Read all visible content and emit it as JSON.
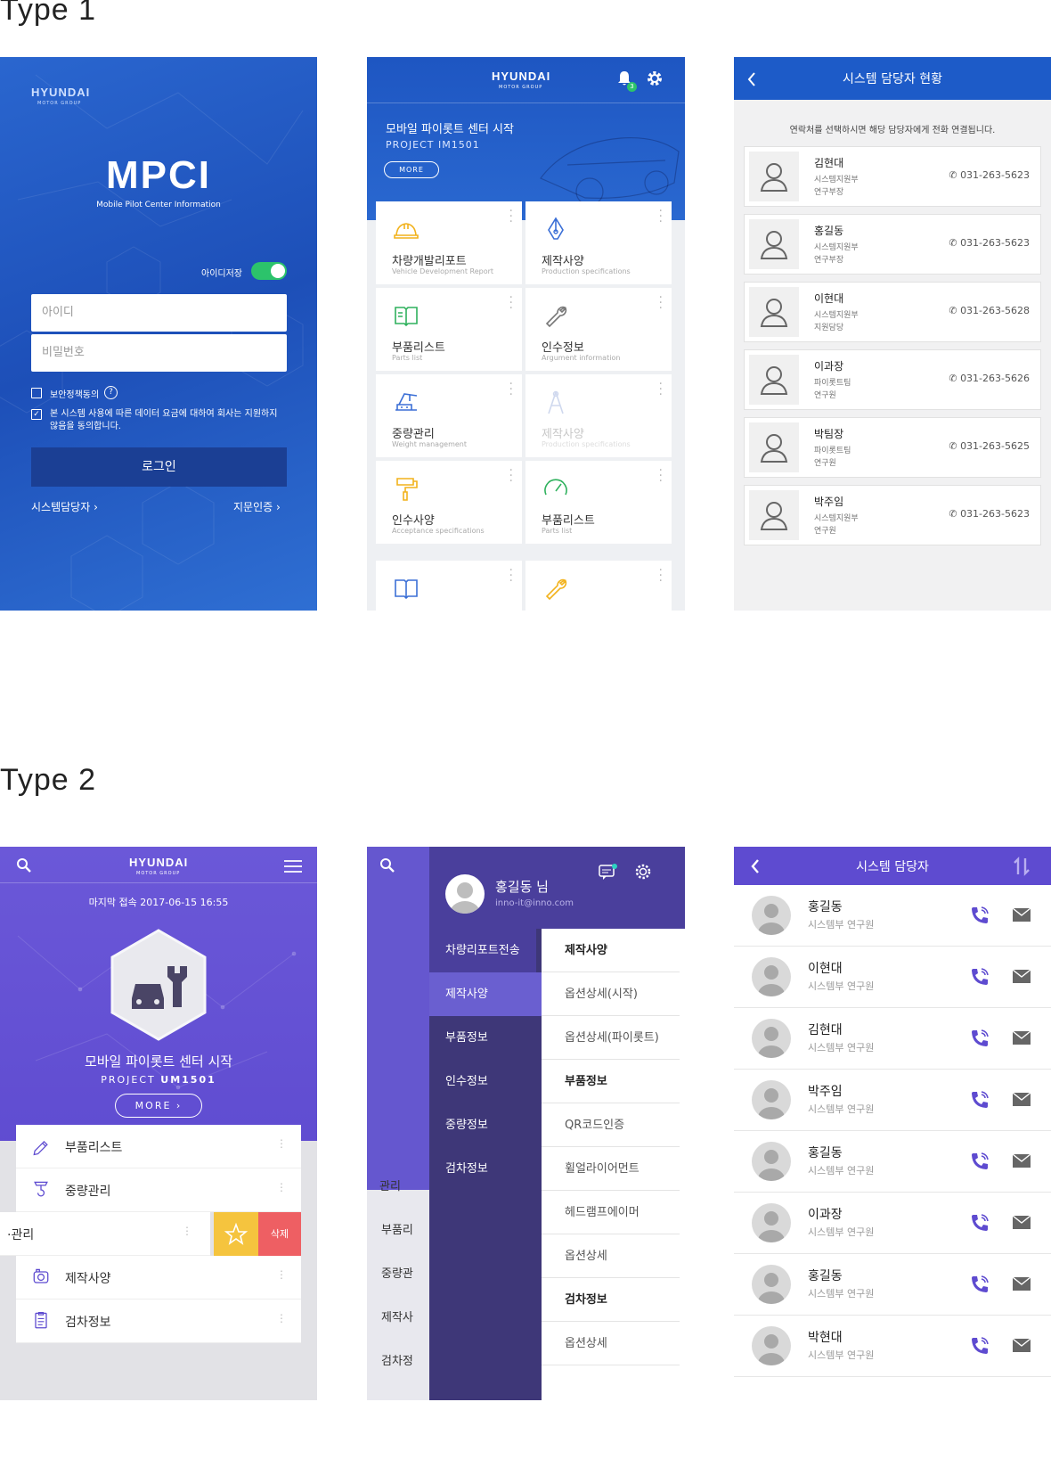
{
  "type1_label": "Type 1",
  "type2_label": "Type 2",
  "brand": {
    "logo": "HYUNDAI",
    "sub": "MOTOR GROUP"
  },
  "login": {
    "app_name": "MPCI",
    "app_full": "Mobile Pilot Center Information",
    "save_id": "아이디저장",
    "id_placeholder": "아이디",
    "pw_placeholder": "비밀번호",
    "security_agree": "보안정책동의",
    "data_agree_1": "본 시스템 사용에 따른 데이터 요금에 대하여 회사는 지원하지",
    "data_agree_2": "않음을 동의합니다.",
    "login_button": "로그인",
    "system_manager": "시스템담당자",
    "fingerprint": "지문인증"
  },
  "dashboard1": {
    "notif_count": "3",
    "banner_title": "모바일 파이롯트 센터 시작",
    "banner_project": "PROJECT IM1501",
    "more": "MORE",
    "tiles": [
      {
        "title": "차량개발리포트",
        "sub": "Vehicle Development Report",
        "icon": "helmet-icon"
      },
      {
        "title": "제작사양",
        "sub": "Production specifications",
        "icon": "pen-nib-icon"
      },
      {
        "title": "부품리스트",
        "sub": "Parts list",
        "icon": "book-icon"
      },
      {
        "title": "인수정보",
        "sub": "Argument information",
        "icon": "wrench-icon"
      },
      {
        "title": "중량관리",
        "sub": "Weight management",
        "icon": "crane-icon"
      },
      {
        "title": "제작사양",
        "sub": "Production specifications",
        "icon": "compass-icon"
      },
      {
        "title": "인수사양",
        "sub": "Acceptance specifications",
        "icon": "paint-roller-icon"
      },
      {
        "title": "부품리스트",
        "sub": "Parts list",
        "icon": "gauge-icon"
      }
    ]
  },
  "contacts1": {
    "title": "시스템 담당자 현황",
    "notice": "연락처를 선택하시면 해당 담당자에게 전화 연결됩니다.",
    "items": [
      {
        "name": "김현대",
        "dept": "시스템지원부",
        "role": "연구부장",
        "phone": "031-263-5623"
      },
      {
        "name": "홍길동",
        "dept": "시스템지원부",
        "role": "연구부장",
        "phone": "031-263-5623"
      },
      {
        "name": "이현대",
        "dept": "시스템지원부",
        "role": "지원담당",
        "phone": "031-263-5628"
      },
      {
        "name": "이과장",
        "dept": "파이롯트팀",
        "role": "연구원",
        "phone": "031-263-5626"
      },
      {
        "name": "박팀장",
        "dept": "파이롯트팀",
        "role": "연구원",
        "phone": "031-263-5625"
      },
      {
        "name": "박주임",
        "dept": "시스템지원부",
        "role": "연구원",
        "phone": "031-263-5623"
      }
    ]
  },
  "dashboard2": {
    "last_access": "마지막 접속 2017-06-15 16:55",
    "banner_title": "모바일 파이롯트 센터 시작",
    "project_prefix": "PROJECT ",
    "project_id": "UM1501",
    "more": "MORE",
    "list": [
      {
        "label": "부품리스트",
        "icon": "pencil-icon"
      },
      {
        "label": "중량관리",
        "icon": "hook-icon"
      },
      {
        "label": "·관리",
        "icon": ""
      },
      {
        "label": "제작사양",
        "icon": "measure-icon"
      },
      {
        "label": "검차정보",
        "icon": "clipboard-icon"
      }
    ],
    "delete": "삭제"
  },
  "drawer": {
    "user_name": "홍길동 님",
    "email": "inno-it@inno.com",
    "behind_items": [
      "관리",
      "부품리",
      "중량관",
      "제작사",
      "검차정"
    ],
    "main_menu": [
      "차량리포트전송",
      "제작사양",
      "부품정보",
      "인수정보",
      "중량정보",
      "검차정보"
    ],
    "sub_menu": [
      {
        "label": "제작사양",
        "bold": true
      },
      {
        "label": "옵션상세(시작)",
        "bold": false
      },
      {
        "label": "옵션상세(파이롯트)",
        "bold": false
      },
      {
        "label": "부품정보",
        "bold": true
      },
      {
        "label": "QR코드인증",
        "bold": false
      },
      {
        "label": "휠얼라이어먼트",
        "bold": false
      },
      {
        "label": "헤드램프에이머",
        "bold": false
      },
      {
        "label": "옵션상세",
        "bold": false
      },
      {
        "label": "검차정보",
        "bold": true
      },
      {
        "label": "옵션상세",
        "bold": false
      }
    ]
  },
  "contacts2": {
    "title": "시스템 담당자",
    "items": [
      {
        "name": "홍길동",
        "dept": "시스템부 연구원"
      },
      {
        "name": "이현대",
        "dept": "시스템부 연구원"
      },
      {
        "name": "김현대",
        "dept": "시스템부 연구원"
      },
      {
        "name": "박주임",
        "dept": "시스템부 연구원"
      },
      {
        "name": "홍길동",
        "dept": "시스템부 연구원"
      },
      {
        "name": "이과장",
        "dept": "시스템부 연구원"
      },
      {
        "name": "홍길동",
        "dept": "시스템부 연구원"
      },
      {
        "name": "박현대",
        "dept": "시스템부 연구원"
      }
    ]
  },
  "colors": {
    "blue_primary": "#1d5bc8",
    "purple_primary": "#5e4bd0",
    "drawer_dark": "#3e3778",
    "star_yellow": "#f5c43e",
    "delete_red": "#ee5f63",
    "toggle_green": "#2cc36b"
  }
}
